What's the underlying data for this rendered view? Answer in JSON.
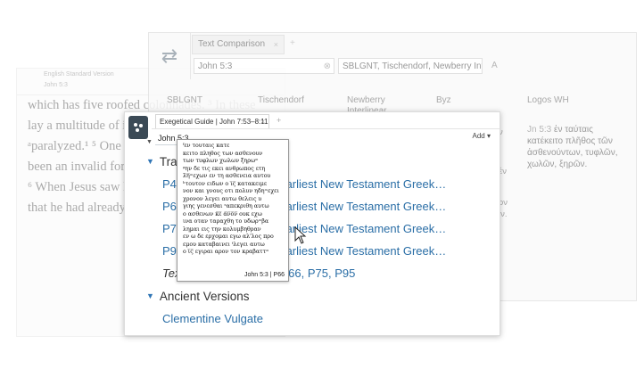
{
  "bible_window": {
    "title": "English Standard Version",
    "reference": "John 5:3",
    "lines": [
      "which has five roofed colonnades. ³ In these",
      "lay a multitude of invalids—blind, lame, and",
      "ᵃparalyzed.¹ ⁵ One man was there who had",
      "been an invalid for thirty-eight years.",
      "⁶ When Jesus saw him lying there and knew",
      "that he had already been there a long time,"
    ]
  },
  "text_comparison": {
    "tab_label": "Text Comparison",
    "tab_close": "×",
    "new_tab": "+",
    "reference": "John 5:3",
    "clear": "⊗",
    "versions": "SBLGNT, Tischendorf, Newberry Inte",
    "font_button": "A",
    "columns": [
      "SBLGNT",
      "Tischendorf",
      "Newberry Interlinear",
      "Byz",
      "Logos WH"
    ],
    "logos_verse": "Jn 5:3",
    "logos_text": "ἐν ταύταις κατέκειτο πλῆθος τῶν ἀσθενούντων, τυφλῶν, χωλῶν, ξηρῶν.",
    "side_bits": [
      "ν",
      "ἐν",
      "ον",
      "ιν."
    ]
  },
  "exegetical_guide": {
    "tab_label": "Exegetical Guide | John 7:53–8:11",
    "tab_close": "×",
    "new_tab": "+",
    "reference": "John 5:3",
    "add_label": "Add ▾",
    "section_translations": "Tra",
    "manuscripts": [
      {
        "prefix": "P4",
        "suffix": "Earliest New Testament Greek…"
      },
      {
        "prefix": "P6",
        "suffix": "Earliest New Testament Greek…"
      },
      {
        "prefix": "P7",
        "suffix": "Earliest New Testament Greek…"
      },
      {
        "prefix": "P9",
        "suffix": "Earliest New Testament Greek…"
      }
    ],
    "text_row_italic": "Tex",
    "text_row_links": "P66, P75, P95",
    "section_ancient": "Ancient Versions",
    "ancient_link": "Clementine Vulgate"
  },
  "popup": {
    "lines": [
      "ᶠεν τουταις κατε",
      "κειτο πληθος των ασθενουν",
      "των τυφλων χωλων ξηρω ͫ",
      "ᵍην δε τις εκει ανθρωπος ετη",
      "λ̅η̅ ͫ εχων εν τη ασθενεια αυτου",
      "ʰτουτον ειδων ο ι̅ς̅ κατακειμε",
      "νον και γνους οτι πολυν ηδη ͫ εχει",
      "χρονον λεγει αυτω θελεις υ",
      "γιης γενεσθαι ˢαπεκριθη αυτω",
      "ο ασθενων κ̅ε̅ α̅ν̅ο̅ν̅ ουκ εχω",
      "ινα οταν ταραχθη το υδωρ ͫ βα",
      "λημαι εις την κολυμβηθραν",
      "εν ω δε ερχομαι εγω αλ'λος προ",
      "εμου καταβαινει ᵗλεγει αυτω",
      "ο ι̅ς̅ εγιραι αρον τον κραβαττ ͫ"
    ],
    "caption": "John 5:3 | P66"
  },
  "icons": {
    "compare": "swap-arrows",
    "logos": "logos-logo",
    "cursor": "arrow-cursor"
  },
  "colors": {
    "link": "#2a6ea6",
    "triangle": "#2f75b5"
  }
}
